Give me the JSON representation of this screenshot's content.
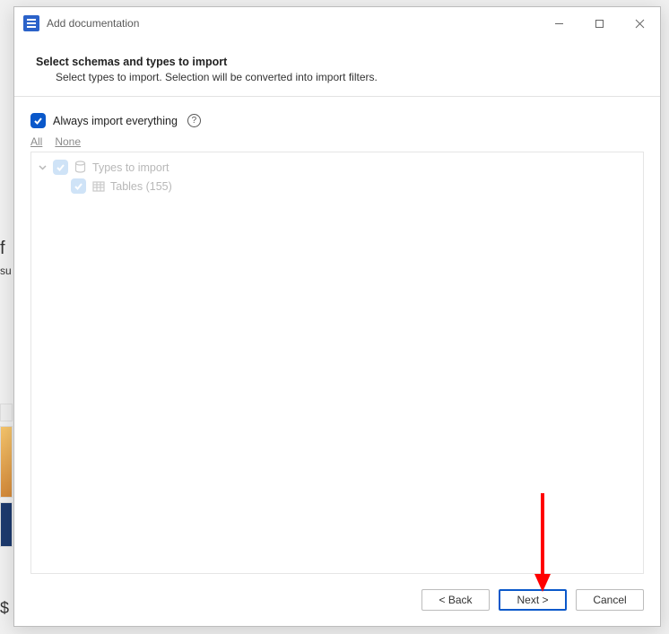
{
  "window": {
    "title": "Add documentation"
  },
  "header": {
    "title": "Select schemas and types to import",
    "subtitle": "Select types to import. Selection will be converted into import filters."
  },
  "options": {
    "always_label": "Always import everything",
    "link_all": "All",
    "link_none": "None"
  },
  "tree": {
    "root_label": "Types to import",
    "child_label": "Tables (155)"
  },
  "buttons": {
    "back": "< Back",
    "next": "Next >",
    "cancel": "Cancel"
  }
}
